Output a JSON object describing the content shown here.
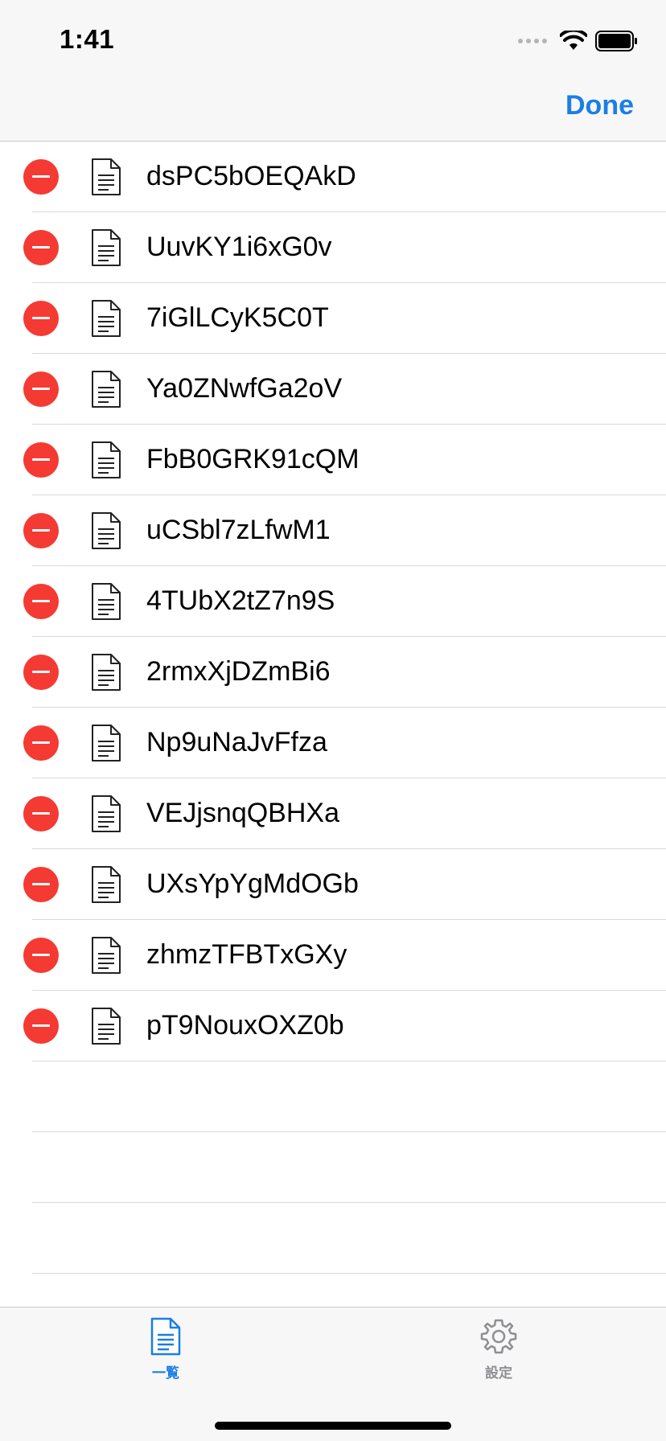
{
  "status_bar": {
    "time": "1:41",
    "icons": [
      "signal-dots-icon",
      "wifi-icon",
      "battery-icon"
    ]
  },
  "nav": {
    "done_label": "Done"
  },
  "colors": {
    "accent": "#1a7ee6",
    "delete": "#f43a32",
    "tab_inactive": "#8e8e93"
  },
  "files": [
    "dsPC5bOEQAkD",
    "UuvKY1i6xG0v",
    "7iGlLCyK5C0T",
    "Ya0ZNwfGa2oV",
    "FbB0GRK91cQM",
    "uCSbl7zLfwM1",
    "4TUbX2tZ7n9S",
    "2rmxXjDZmBi6",
    "Np9uNaJvFfza",
    "VEJjsnqQBHXa",
    "UXsYpYgMdOGb",
    "zhmzTFBTxGXy",
    "pT9NouxOXZ0b"
  ],
  "tabs": {
    "list": {
      "label": "一覧",
      "icon": "document-icon",
      "selected": true
    },
    "settings": {
      "label": "設定",
      "icon": "gear-icon",
      "selected": false
    }
  }
}
